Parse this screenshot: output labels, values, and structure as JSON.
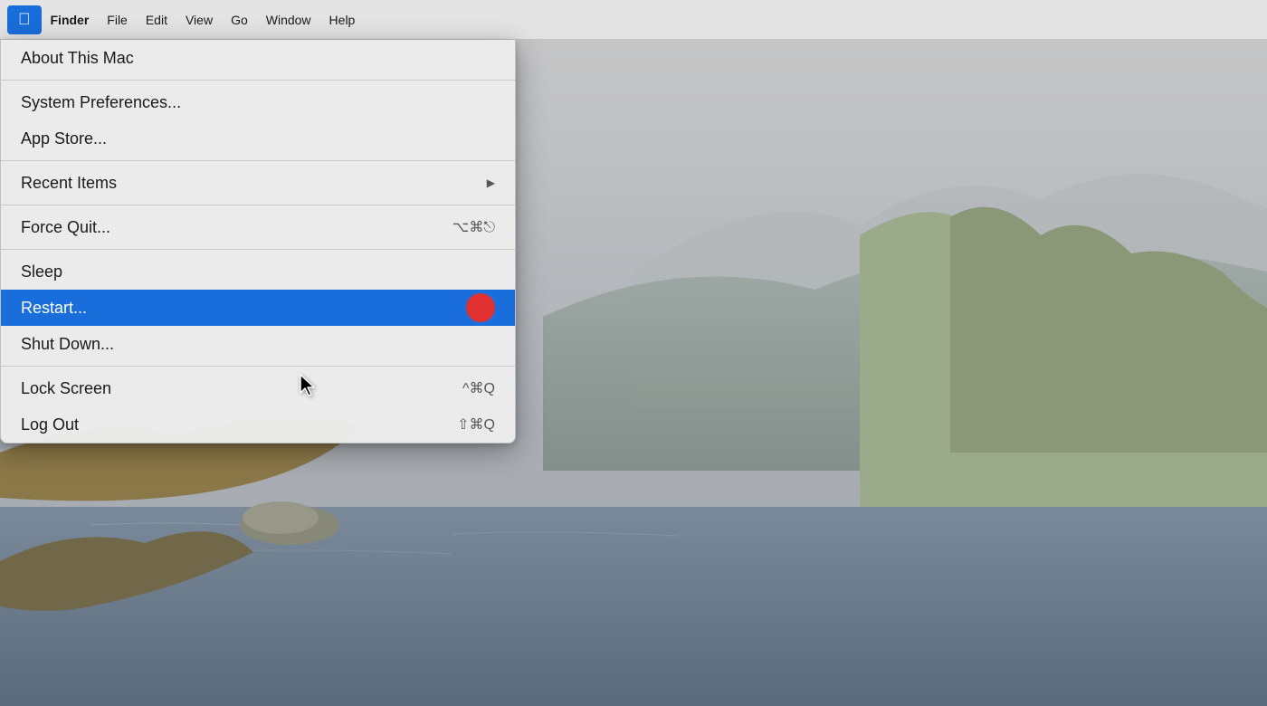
{
  "desktop": {
    "background_description": "macOS desktop with coastal landscape"
  },
  "menubar": {
    "apple_icon": "🍎",
    "items": [
      {
        "id": "apple",
        "label": "",
        "special": "apple"
      },
      {
        "id": "finder",
        "label": "Finder",
        "bold": true
      },
      {
        "id": "file",
        "label": "File"
      },
      {
        "id": "edit",
        "label": "Edit"
      },
      {
        "id": "view",
        "label": "View"
      },
      {
        "id": "go",
        "label": "Go"
      },
      {
        "id": "window",
        "label": "Window"
      },
      {
        "id": "help",
        "label": "Help"
      }
    ]
  },
  "apple_menu": {
    "items": [
      {
        "id": "about",
        "label": "About This Mac",
        "shortcut": "",
        "has_arrow": false,
        "separator_after": false,
        "separator_before": false
      },
      {
        "id": "sep1",
        "type": "separator"
      },
      {
        "id": "system_prefs",
        "label": "System Preferences...",
        "shortcut": "",
        "has_arrow": false
      },
      {
        "id": "app_store",
        "label": "App Store...",
        "shortcut": "",
        "has_arrow": false
      },
      {
        "id": "sep2",
        "type": "separator"
      },
      {
        "id": "recent_items",
        "label": "Recent Items",
        "shortcut": "",
        "has_arrow": true
      },
      {
        "id": "sep3",
        "type": "separator"
      },
      {
        "id": "force_quit",
        "label": "Force Quit...",
        "shortcut": "⌥⌘⎋",
        "has_arrow": false
      },
      {
        "id": "sep4",
        "type": "separator"
      },
      {
        "id": "sleep",
        "label": "Sleep",
        "shortcut": "",
        "has_arrow": false
      },
      {
        "id": "restart",
        "label": "Restart...",
        "shortcut": "",
        "has_arrow": false,
        "highlighted": true,
        "has_indicator": true
      },
      {
        "id": "shut_down",
        "label": "Shut Down...",
        "shortcut": "",
        "has_arrow": false
      },
      {
        "id": "sep5",
        "type": "separator"
      },
      {
        "id": "lock_screen",
        "label": "Lock Screen",
        "shortcut": "^⌘Q",
        "has_arrow": false
      },
      {
        "id": "log_out",
        "label": "Log Out",
        "shortcut": "⇧⌘Q",
        "has_arrow": false
      }
    ]
  },
  "labels": {
    "apple_symbol": "",
    "finder": "Finder",
    "file": "File",
    "edit": "Edit",
    "view": "View",
    "go": "Go",
    "window": "Window",
    "help": "Help",
    "about_this_mac": "About This Mac",
    "system_preferences": "System Preferences...",
    "app_store": "App Store...",
    "recent_items": "Recent Items",
    "force_quit": "Force Quit...",
    "force_quit_shortcut": "⌥⌘⎋",
    "sleep": "Sleep",
    "restart": "Restart...",
    "shut_down": "Shut Down...",
    "lock_screen": "Lock Screen",
    "lock_screen_shortcut": "^⌘Q",
    "log_out": "Log Out",
    "log_out_shortcut": "⇧⌘Q"
  }
}
